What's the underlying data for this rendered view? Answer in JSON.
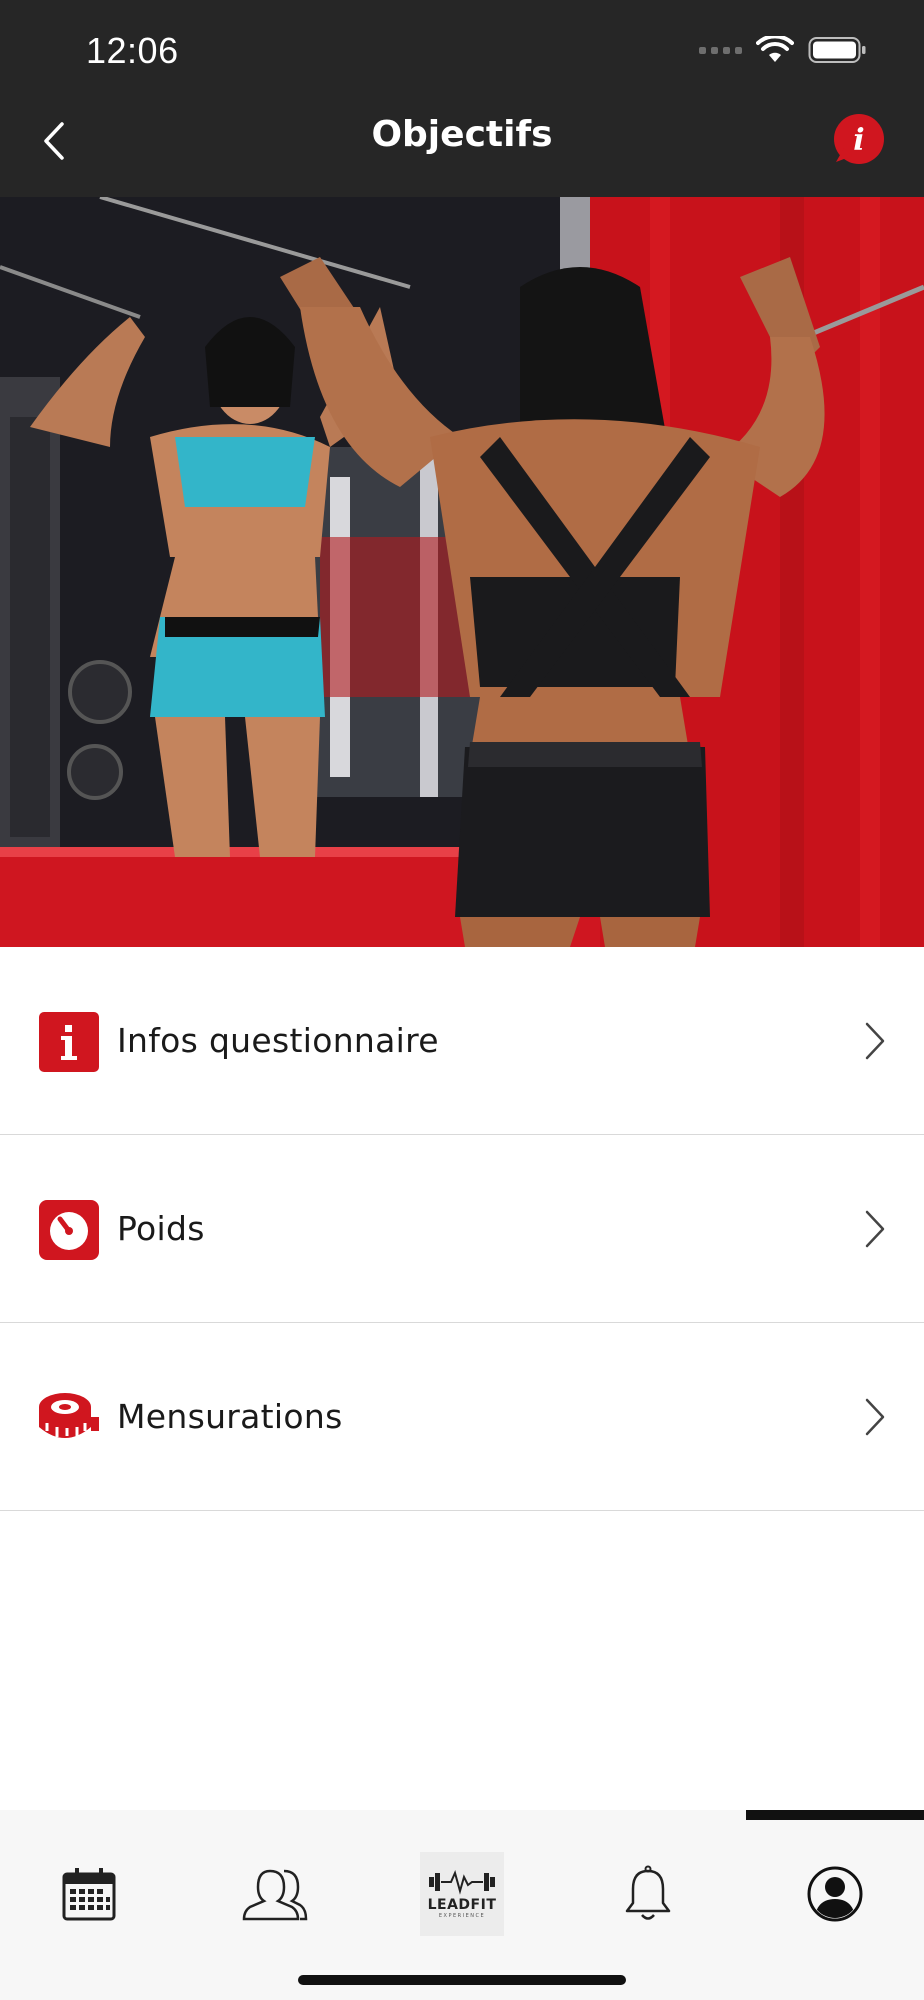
{
  "status_bar": {
    "time": "12:06"
  },
  "nav": {
    "title": "Objectifs",
    "back_icon": "chevron-left-icon",
    "info_icon": "info-bubble-icon"
  },
  "hero": {
    "description_icon": "hero-photo"
  },
  "menu": {
    "items": [
      {
        "label": "Infos questionnaire",
        "icon": "info-square-icon"
      },
      {
        "label": "Poids",
        "icon": "scale-icon"
      },
      {
        "label": "Mensurations",
        "icon": "measuring-tape-icon"
      }
    ]
  },
  "tabbar": {
    "tabs": [
      {
        "icon": "calendar-icon"
      },
      {
        "icon": "users-icon"
      },
      {
        "icon": "leadfit-logo",
        "logo_text": "LEADFIT",
        "logo_sub": "EXPERIENCE"
      },
      {
        "icon": "bell-icon"
      },
      {
        "icon": "profile-icon",
        "selected": true
      }
    ]
  },
  "colors": {
    "accent": "#d0161f",
    "header_bg": "#262626",
    "tabbar_bg": "#f7f7f7"
  }
}
